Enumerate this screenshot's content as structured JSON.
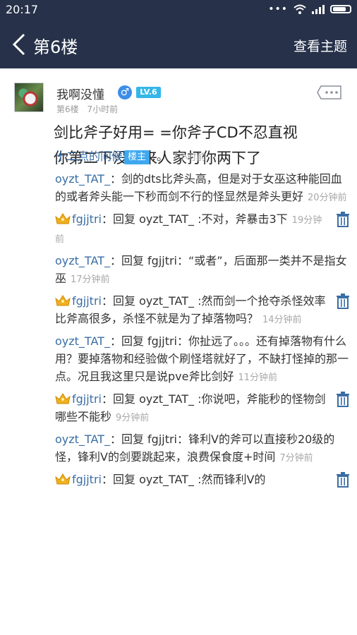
{
  "status": {
    "time": "20:17"
  },
  "nav": {
    "title": "第6楼",
    "action": "查看主题"
  },
  "post": {
    "username": "我啊没懂",
    "level": "LV.6",
    "floor": "第6楼",
    "time": "7小时前",
    "content_line1": "剑比斧子好用= =你斧子CD不忍直视",
    "content_line2": "你第二下没出来人家打你两下了"
  },
  "replies": [
    {
      "user": "十二点的问候",
      "badge": "楼主",
      "text": "：。",
      "time": "7小时前"
    },
    {
      "user": "oyzt_TAT_",
      "text": "：剑的dts比斧头高，但是对于女巫这种能回血的或者斧头能一下秒而剑不行的怪显然是斧头更好",
      "time": "20分钟前"
    },
    {
      "user": "fgjjtri",
      "crown": true,
      "trash": true,
      "text": "：回复 oyzt_TAT_ :不对，斧暴击3下",
      "time": "19分钟前"
    },
    {
      "user": "oyzt_TAT_",
      "text": "：回复 fgjjtri：“或者”，后面那一类并不是指女巫",
      "time": "17分钟前"
    },
    {
      "user": "fgjjtri",
      "crown": true,
      "trash": true,
      "text": "：回复 oyzt_TAT_ :然而剑一个抢夺杀怪效率比斧高很多，杀怪不就是为了掉落物吗？",
      "time": "14分钟前"
    },
    {
      "user": "oyzt_TAT_",
      "text": "：回复 fgjjtri：你扯远了。。。还有掉落物有什么用？要掉落物和经验做个刷怪塔就好了，不缺打怪掉的那一点。况且我这里只是说pve斧比剑好",
      "time": "11分钟前"
    },
    {
      "user": "fgjjtri",
      "crown": true,
      "trash": true,
      "text": "：回复 oyzt_TAT_ :你说吧，斧能秒的怪物剑哪些不能秒",
      "time": "9分钟前"
    },
    {
      "user": "oyzt_TAT_",
      "text": "：回复 fgjjtri：锋利V的斧可以直接秒20级的怪，锋利V的剑要跳起来，浪费保食度+时间",
      "time": "7分钟前"
    },
    {
      "user": "fgjjtri",
      "crown": true,
      "trash": true,
      "text": "：回复 oyzt_TAT_ :然而锋利V的",
      "time": ""
    }
  ]
}
